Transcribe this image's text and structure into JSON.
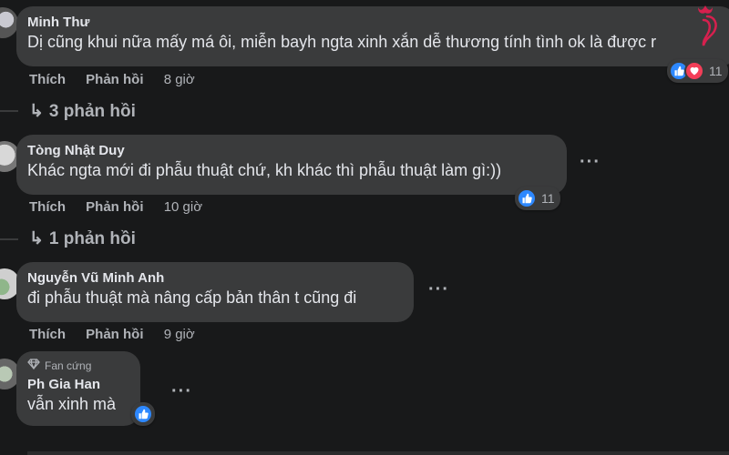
{
  "comments": [
    {
      "name": "Minh Thư",
      "text": "Dị cũng khui nữa mấy má ôi, miễn bayh ngta xinh xắn dễ thương tính tình ok là được r",
      "actions": {
        "like": "Thích",
        "reply": "Phản hồi",
        "time": "8 giờ"
      },
      "reactions": {
        "icons": [
          "like-icon",
          "love-icon"
        ],
        "count": "11"
      },
      "replies_label": "3 phản hồi"
    },
    {
      "name": "Tòng Nhật Duy",
      "text": "Khác ngta mới đi phẫu thuật chứ, kh khác thì phẫu thuật làm gì:))",
      "actions": {
        "like": "Thích",
        "reply": "Phản hồi",
        "time": "10 giờ"
      },
      "reactions": {
        "icons": [
          "like-icon"
        ],
        "count": "11"
      },
      "replies_label": "1 phản hồi"
    },
    {
      "name": "Nguyễn Vũ Minh Anh",
      "text": "đi phẫu thuật mà nâng cấp bản thân t cũng đi",
      "actions": {
        "like": "Thích",
        "reply": "Phản hồi",
        "time": "9 giờ"
      }
    },
    {
      "badge": "Fan cứng",
      "name": "Ph Gia Han",
      "text": "vẫn xinh mà",
      "reactions": {
        "icons": [
          "like-icon"
        ]
      }
    }
  ],
  "colors": {
    "background": "#18191a",
    "bubble": "#3a3b3c",
    "text": "#e4e6eb",
    "secondary": "#b0b3b8",
    "like": "#2d88ff",
    "love": "#f33e58",
    "logo": "#d6204e"
  }
}
